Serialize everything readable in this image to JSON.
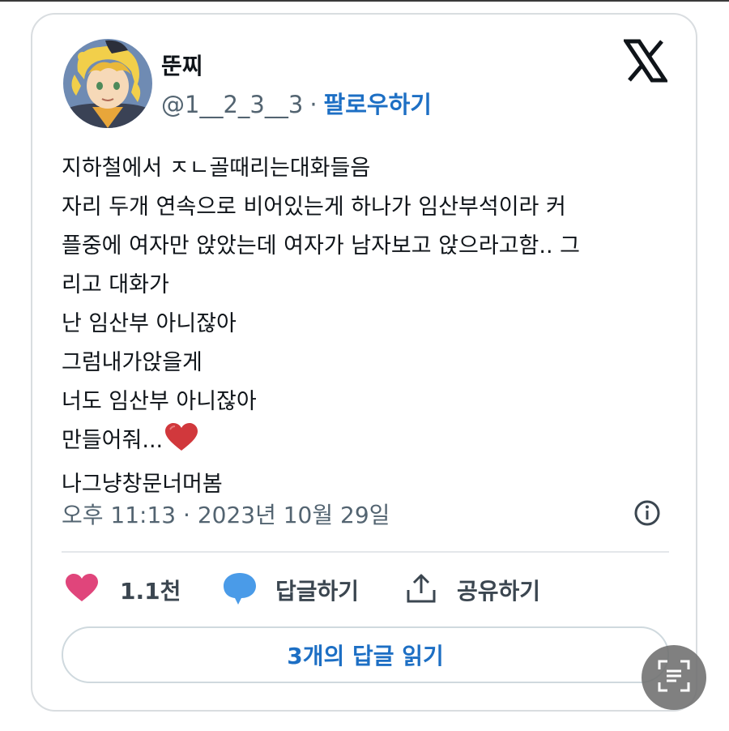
{
  "tweet": {
    "author_name": "뚠찌",
    "handle": "@1__2_3__3",
    "separator": "·",
    "follow_label": "팔로우하기",
    "lines": [
      "지하철에서 ㅈㄴ골때리는대화들음",
      "자리 두개 연속으로 비어있는게 하나가 임산부석이라 커",
      "플중에 여자만 앉았는데 여자가 남자보고 앉으라고함.. 그",
      "리고 대화가",
      "난 임산부 아니잖아",
      "그럼내가앉을게",
      "너도 임산부 아니잖아",
      "만들어줘...",
      "나그냥창문너머봄"
    ],
    "emoji": "red-heart-icon",
    "timestamp": "오후 11:13 · 2023년 10월 29일"
  },
  "actions": {
    "likes": "1.1천",
    "reply_label": "답글하기",
    "share_label": "공유하기"
  },
  "read_replies_label": "3개의 답글 읽기",
  "colors": {
    "link": "#1d6fc4",
    "like_heart": "#e0457b",
    "reply_bubble": "#4a9be8",
    "muted_text": "#536471"
  }
}
